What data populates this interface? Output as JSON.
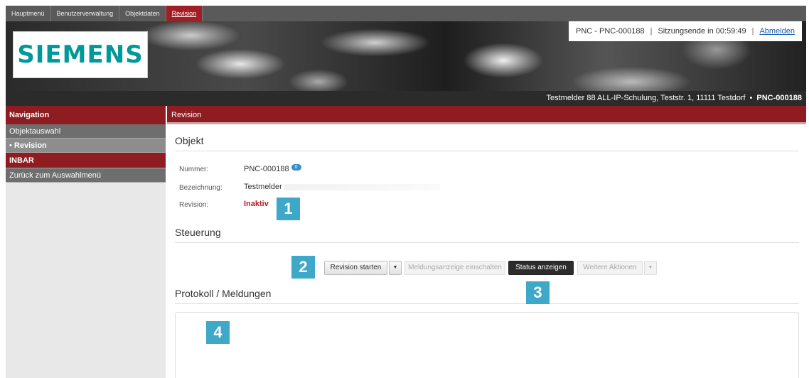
{
  "topnav": {
    "tabs": [
      {
        "label": "Hauptmenü"
      },
      {
        "label": "Benutzerverwaltung"
      },
      {
        "label": "Objektdaten"
      },
      {
        "label": "Revision"
      }
    ],
    "active_tab": "Revision"
  },
  "banner": {
    "logo_text": "SIEMENS",
    "session": {
      "object": "PNC - PNC-000188",
      "separator": "|",
      "session_end": "Sitzungsende in 00:59:49",
      "logout_label": "Abmelden"
    }
  },
  "address_bar": {
    "address": "Testmelder 88 ALL-IP-Schulung, Teststr. 1, 11111 Testdorf",
    "dot": "•",
    "object_id": "PNC-000188"
  },
  "sidebar": {
    "heading": "Navigation",
    "items": [
      {
        "label": "Objektauswahl"
      },
      {
        "label": "• Revision"
      },
      {
        "label": "INBAR"
      },
      {
        "label": "Zurück zum Auswahlmenü"
      }
    ]
  },
  "main": {
    "heading": "Revision",
    "object_section": {
      "title": "Objekt",
      "fields": [
        {
          "label": "Nummer:",
          "value": "PNC-000188",
          "badge": "0"
        },
        {
          "label": "Bezeichnung:",
          "value": "Testmelder"
        },
        {
          "label": "Revision:",
          "value": "Inaktiv"
        }
      ]
    },
    "control_section": {
      "title": "Steuerung",
      "buttons": {
        "start_revision": "Revision starten",
        "dropdown_caret": "▼",
        "message_display": "Meldungsanzeige einschalten",
        "show_status": "Status anzeigen",
        "more_actions": "Weitere Aktionen"
      }
    },
    "log_section": {
      "title": "Protokoll / Meldungen"
    }
  },
  "markers": [
    "1",
    "2",
    "3",
    "4"
  ],
  "colors": {
    "brand_red": "#8e1c21",
    "active_tab_red": "#a01e24",
    "logo_teal": "#009999",
    "marker_blue": "#3ea8c8",
    "status_red": "#b52025"
  }
}
